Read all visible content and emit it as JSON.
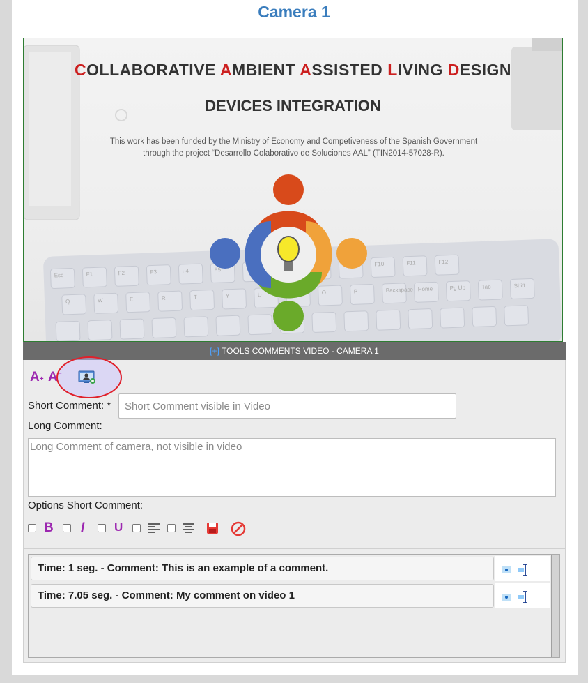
{
  "camera_title": "Camera 1",
  "video": {
    "title_line1_parts": [
      {
        "text": "C",
        "red": true
      },
      {
        "text": "OLLABORATIVE ",
        "red": false
      },
      {
        "text": "A",
        "red": true
      },
      {
        "text": "MBIENT ",
        "red": false
      },
      {
        "text": "A",
        "red": true
      },
      {
        "text": "SSISTED ",
        "red": false
      },
      {
        "text": "L",
        "red": true
      },
      {
        "text": "IVING ",
        "red": false
      },
      {
        "text": "D",
        "red": true
      },
      {
        "text": "ESIGN",
        "red": false
      }
    ],
    "title_line2": "DEVICES INTEGRATION",
    "funding_line1": "This work has been funded by the Ministry of Economy and Competiveness of the Spanish Government",
    "funding_line2": "through the project “Desarrollo Colaborativo de Soluciones AAL” (TIN2014-57028-R).",
    "keyboard_keys": [
      "Esc",
      "F1",
      "F2",
      "F3",
      "F4",
      "F5",
      "F6",
      "F7",
      "F8",
      "F9",
      "F10",
      "F11",
      "F12",
      "Q",
      "W",
      "E",
      "R",
      "T",
      "Y",
      "U",
      "I",
      "O",
      "P",
      "Backspace",
      "Home",
      "Pg Up",
      "Tab",
      "Shift"
    ]
  },
  "tools_bar": {
    "toggle": "[+]",
    "label": " TOOLS COMMENTS VIDEO - CAMERA 1"
  },
  "toolbar": {
    "font_increase": "A",
    "font_increase_sup": "+",
    "font_decrease": "A",
    "font_decrease_sup": "−",
    "capture_icon": "screen-capture-icon"
  },
  "form": {
    "short_label": "Short Comment: *",
    "short_placeholder": "Short Comment visible in Video",
    "short_value": "",
    "long_label": "Long Comment:",
    "long_placeholder": "Long Comment of camera, not visible in video",
    "long_value": "",
    "options_label": "Options Short Comment:",
    "options": [
      {
        "icon": "bold-icon",
        "glyph": "B",
        "checked": false
      },
      {
        "icon": "italic-icon",
        "glyph": "I",
        "checked": false
      },
      {
        "icon": "underline-icon",
        "glyph": "U",
        "checked": false
      },
      {
        "icon": "align-left-icon",
        "checked": false
      },
      {
        "icon": "align-center-icon",
        "checked": false
      }
    ],
    "save_icon": "save-icon",
    "cancel_icon": "cancel-icon"
  },
  "comments": [
    {
      "text": "Time: 1 seg. - Comment: This is an example of a comment.",
      "icons": [
        "view-icon",
        "edit-icon"
      ]
    },
    {
      "text": "Time: 7.05 seg. - Comment: My comment on video 1",
      "icons": [
        "view-icon",
        "edit-icon"
      ]
    }
  ],
  "colors": {
    "accent_title": "#3a7dbd",
    "purple": "#9c27b0",
    "highlight_ring": "#e0202a",
    "tools_bar": "#6b6b6b"
  }
}
